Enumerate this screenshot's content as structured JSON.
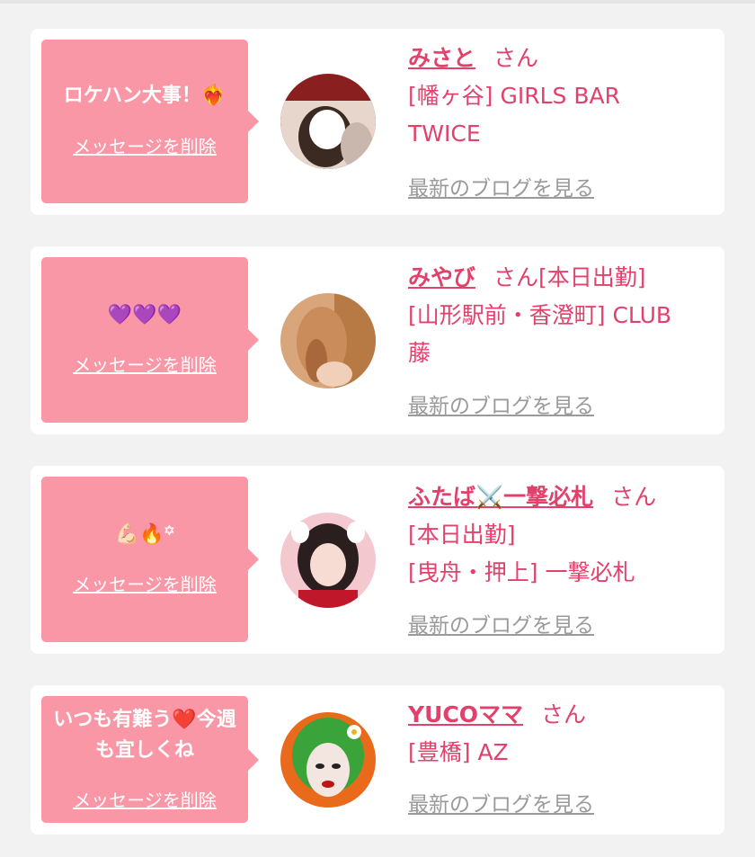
{
  "cards": [
    {
      "message": "ロケハン大事！❤️‍🔥",
      "delete_label": "メッセージを削除",
      "name": "みさと",
      "honorific": "さん",
      "status": "",
      "shop_line1": "[幡ヶ谷] GIRLS BAR",
      "shop_line2": "TWICE",
      "blog_label": "最新のブログを見る"
    },
    {
      "message": "💜💜💜",
      "delete_label": "メッセージを削除",
      "name": "みやび",
      "honorific": "さん",
      "status": "[本日出勤]",
      "shop_line1": "[山形駅前・香澄町] CLUB",
      "shop_line2": "藤",
      "blog_label": "最新のブログを見る"
    },
    {
      "message": "💪🏻🔥꙳",
      "delete_label": "メッセージを削除",
      "name": "ふたば⚔️一撃必札",
      "honorific": "さん",
      "status": "[本日出勤]",
      "shop_line1": "[曳舟・押上] 一撃必札",
      "shop_line2": "",
      "blog_label": "最新のブログを見る"
    },
    {
      "message": "いつも有難う❤️今週も宜しくね",
      "delete_label": "メッセージを削除",
      "name": "YUCOママ",
      "honorific": "さん",
      "status": "",
      "shop_line1": "[豊橋] AZ",
      "shop_line2": "",
      "blog_label": "最新のブログを見る"
    }
  ],
  "colors": {
    "accent": "#e2416c",
    "bubble": "#fa97a6",
    "link_gray": "#9a9a9a",
    "background": "#f2f2f2"
  }
}
